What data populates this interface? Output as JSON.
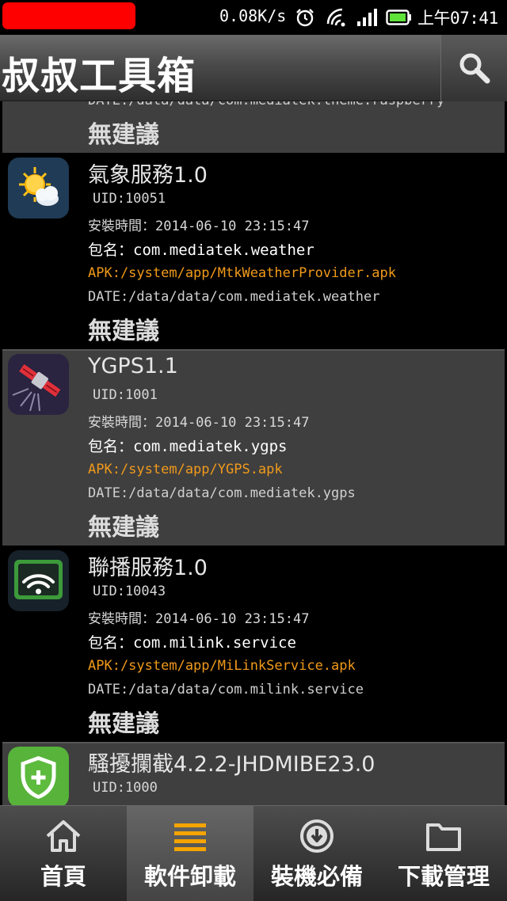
{
  "status_bar": {
    "network_speed": "0.08K/s",
    "time": "上午07:41",
    "icons": [
      "alarm-icon",
      "wifi-icon",
      "signal-icon",
      "battery-icon"
    ]
  },
  "header": {
    "title": "叔叔工具箱",
    "search_icon": "search-icon"
  },
  "list": {
    "partial_top": {
      "data_path": "DATE:/data/data/com.mediatek.theme.raspberry",
      "advice": "無建議"
    },
    "items": [
      {
        "name": "氣象服務1.0",
        "uid": "UID:10051",
        "install_time": "安裝時間：2014-06-10 23:15:47",
        "package": "包名：com.mediatek.weather",
        "apk": "APK:/system/app/MtkWeatherProvider.apk",
        "data_path": "DATE:/data/data/com.mediatek.weather",
        "advice": "無建議",
        "icon": "weather-icon"
      },
      {
        "name": "YGPS1.1",
        "uid": "UID:1001",
        "install_time": "安裝時間：2014-06-10 23:15:47",
        "package": "包名：com.mediatek.ygps",
        "apk": "APK:/system/app/YGPS.apk",
        "data_path": "DATE:/data/data/com.mediatek.ygps",
        "advice": "無建議",
        "icon": "satellite-icon"
      },
      {
        "name": "聯播服務1.0",
        "uid": "UID:10043",
        "install_time": "安裝時間：2014-06-10 23:15:47",
        "package": "包名：com.milink.service",
        "apk": "APK:/system/app/MiLinkService.apk",
        "data_path": "DATE:/data/data/com.milink.service",
        "advice": "無建議",
        "icon": "cast-icon"
      },
      {
        "name": "騷擾攔截4.2.2-JHDMIBE23.0",
        "uid": "UID:1000",
        "install_time": "",
        "package": "",
        "apk": "",
        "data_path": "",
        "advice": "",
        "icon": "shield-icon"
      }
    ]
  },
  "bottom_nav": {
    "items": [
      {
        "label": "首頁",
        "icon": "home-icon",
        "active": false
      },
      {
        "label": "軟件卸載",
        "icon": "menu-icon",
        "active": true
      },
      {
        "label": "裝機必備",
        "icon": "download-icon",
        "active": false
      },
      {
        "label": "下載管理",
        "icon": "folder-icon",
        "active": false
      }
    ]
  },
  "colors": {
    "accent": "#f5a400",
    "apk_text": "#f19a1a",
    "item_gray": "#3f3f3f",
    "status_pill": "#ff0000"
  }
}
